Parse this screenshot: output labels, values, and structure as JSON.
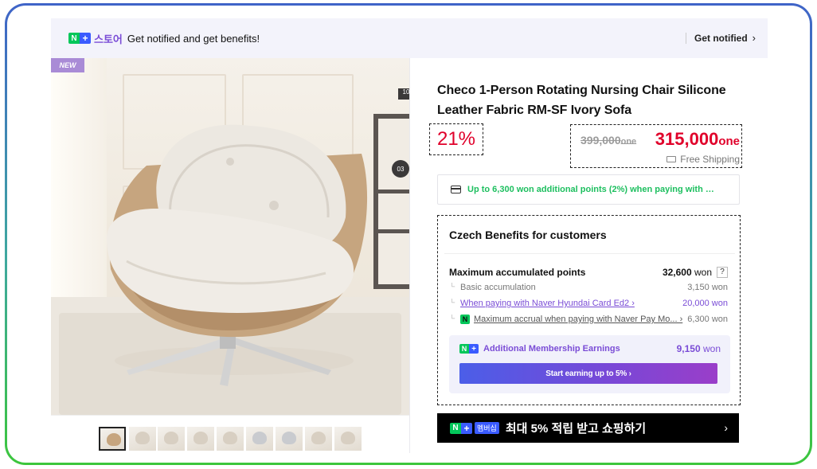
{
  "banner": {
    "logo_n": "N",
    "logo_plus": "+",
    "store_label": "스토어",
    "message": "Get notified and get benefits!",
    "action_label": "Get notified",
    "action_chevron": "›"
  },
  "gallery": {
    "badge": "NEW",
    "thumbnail_count": 9,
    "selected_thumbnail": 1
  },
  "product": {
    "title": "Checo 1-Person Rotating Nursing Chair Silicone Leather Fabric RM-SF Ivory Sofa",
    "discount": "21%",
    "original_price": "399,000",
    "original_unit": "one",
    "sale_price": "315,000",
    "sale_unit": "one",
    "shipping": "Free Shipping"
  },
  "points_notice": "Up to 6,300 won additional points (2%) when paying with …",
  "benefits": {
    "title": "Czech Benefits for customers",
    "max_label": "Maximum accumulated points",
    "max_value": "32,600",
    "max_unit": "won",
    "help": "?",
    "rows": [
      {
        "label": "Basic accumulation",
        "value": "3,150 won"
      },
      {
        "label": "When paying with Naver Hyundai Card Ed2 ›",
        "value": "20,000 won"
      },
      {
        "label": "Maximum accrual when paying with Naver Pay Mo... ›",
        "value": "6,300 won"
      }
    ],
    "membership": {
      "label": "Additional Membership Earnings",
      "value": "9,150",
      "unit": "won",
      "button": "Start earning up to 5% ›"
    }
  },
  "promo": {
    "tag": "멤버십",
    "text": "최대 5% 적립 받고 쇼핑하기",
    "chevron": "›"
  },
  "colors": {
    "accent_red": "#e0002a",
    "naver_green": "#03c75a",
    "membership_purple": "#7a4cd6"
  }
}
